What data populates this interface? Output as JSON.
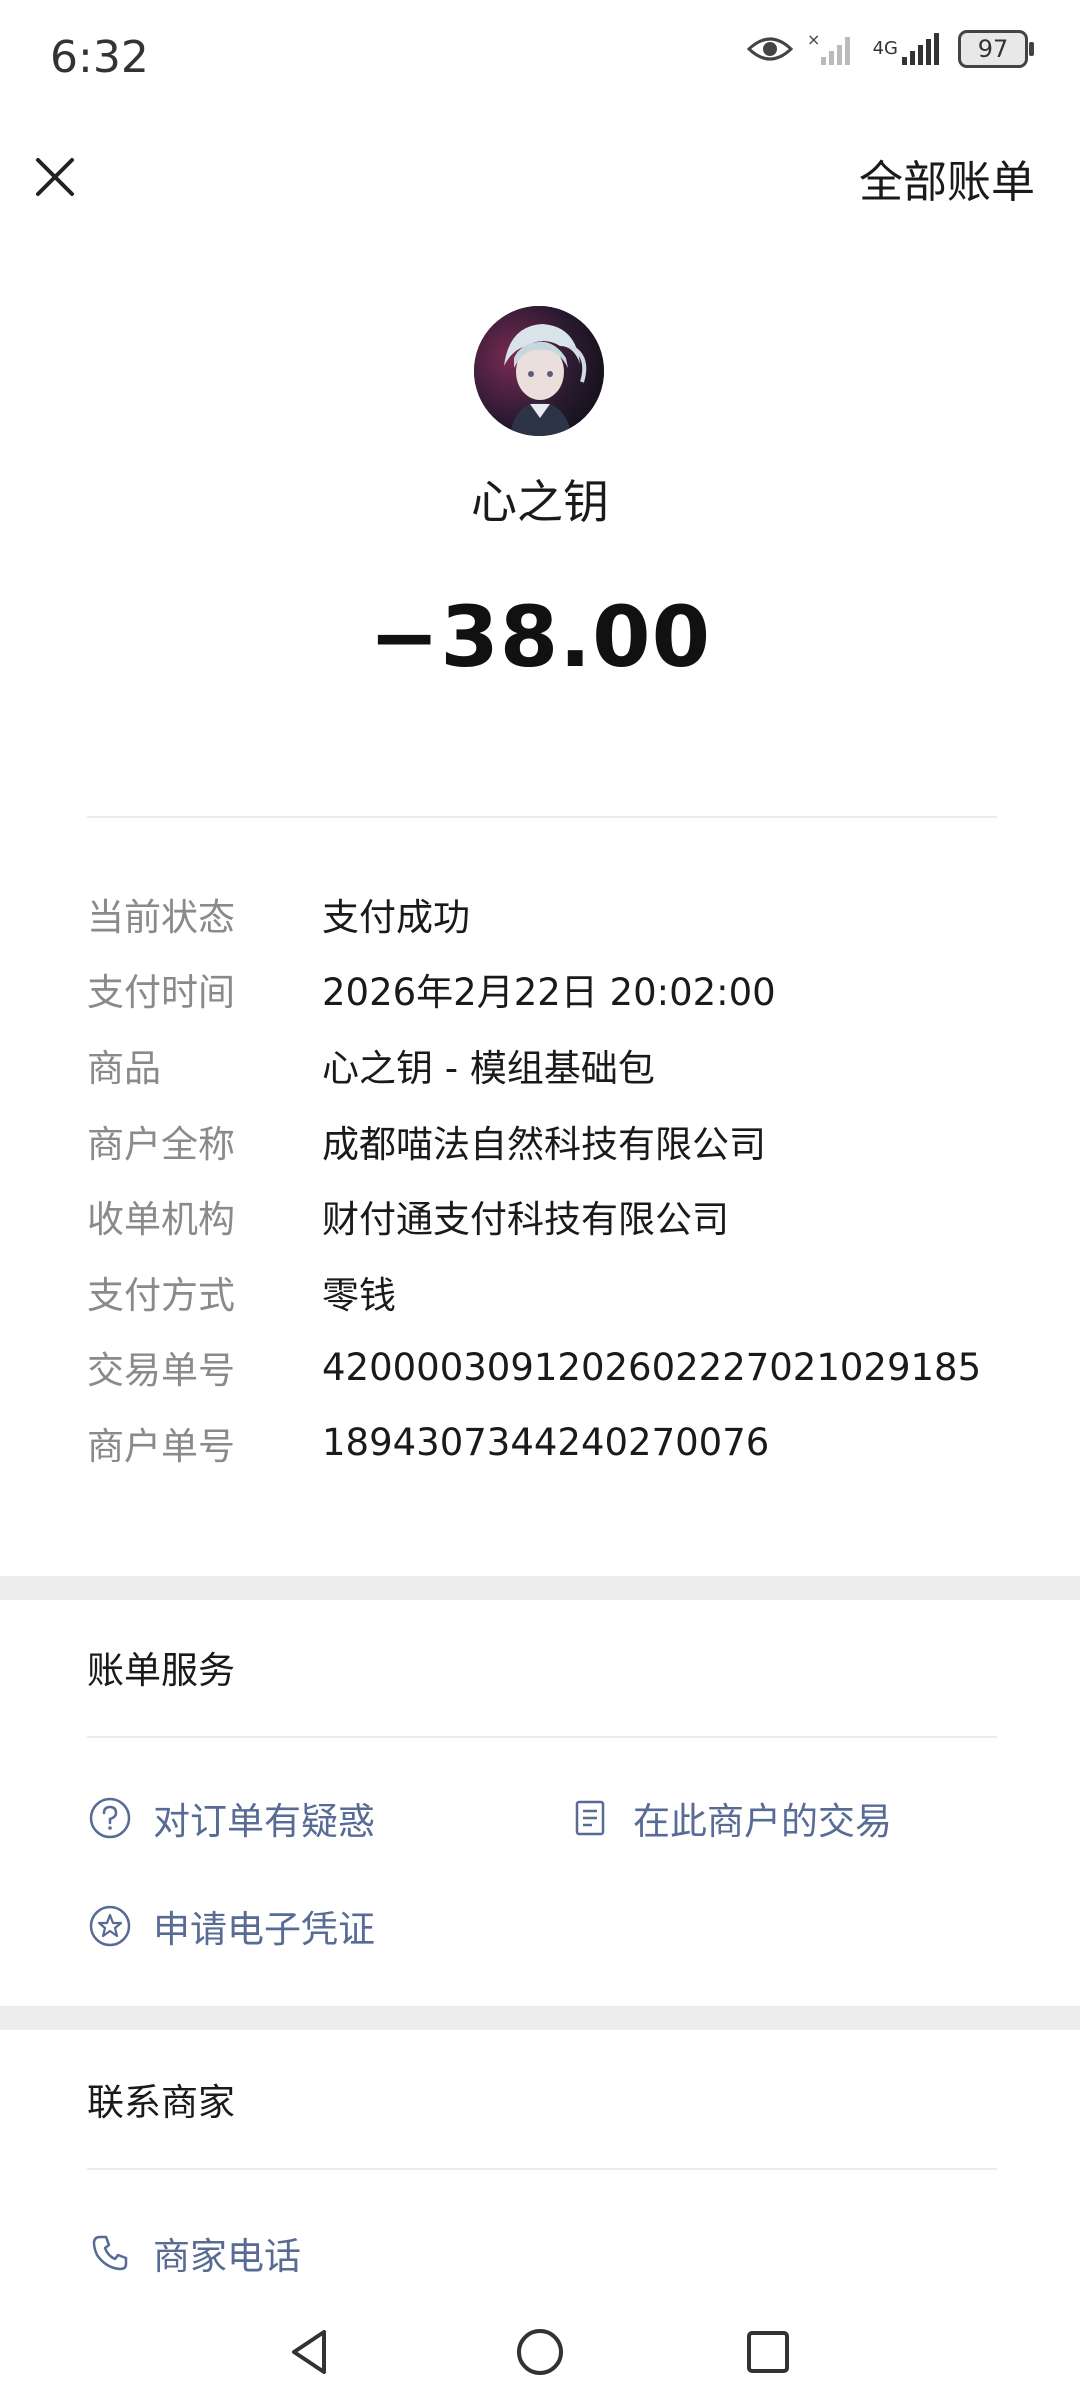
{
  "status_bar": {
    "time": "6:32",
    "battery": "97",
    "network": "4G"
  },
  "header": {
    "close_icon": "close-icon",
    "all_bills_label": "全部账单"
  },
  "transaction": {
    "merchant_name": "心之钥",
    "amount": "−38.00"
  },
  "details": [
    {
      "label": "当前状态",
      "value": "支付成功"
    },
    {
      "label": "支付时间",
      "value": "2026年2月22日 20:02:00"
    },
    {
      "label": "商品",
      "value": "心之钥 - 模组基础包"
    },
    {
      "label": "商户全称",
      "value": "成都喵法自然科技有限公司"
    },
    {
      "label": "收单机构",
      "value": "财付通支付科技有限公司"
    },
    {
      "label": "支付方式",
      "value": "零钱"
    },
    {
      "label": "交易单号",
      "value": "4200003091202602227021029185"
    },
    {
      "label": "商户单号",
      "value": "1894307344240270076"
    }
  ],
  "bill_services": {
    "title": "账单服务",
    "items": [
      {
        "label": "对订单有疑惑",
        "icon": "question-circle-icon"
      },
      {
        "label": "在此商户的交易",
        "icon": "document-icon"
      },
      {
        "label": "申请电子凭证",
        "icon": "star-badge-icon"
      }
    ]
  },
  "contact_merchant": {
    "title": "联系商家",
    "items": [
      {
        "label": "商家电话",
        "icon": "phone-icon"
      }
    ]
  },
  "colors": {
    "link": "#576b95",
    "label_gray": "#8a8a8a",
    "band_gray": "#ededed"
  }
}
